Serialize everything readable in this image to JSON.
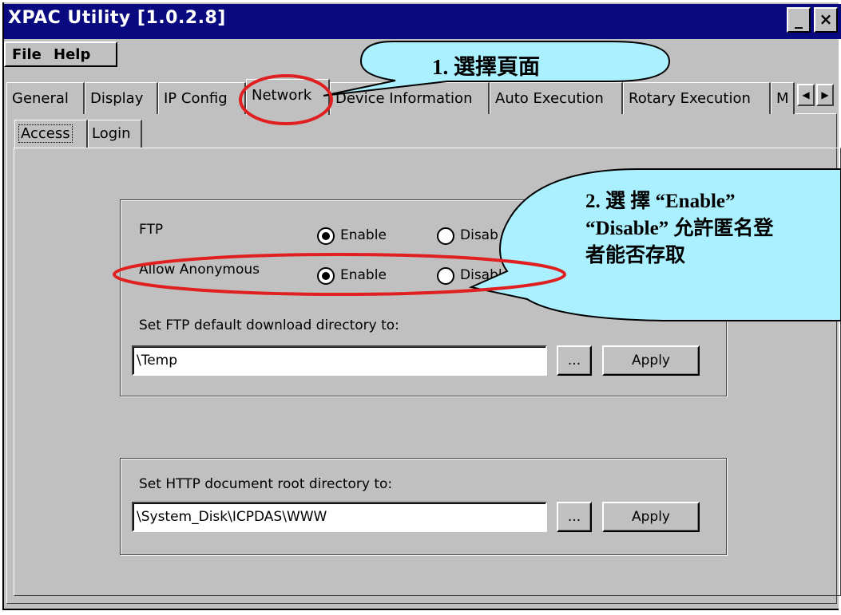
{
  "window": {
    "title": "XPAC Utility  [1.0.2.8]",
    "minimize_label": "_",
    "close_label": "×"
  },
  "menu": [
    "File",
    "Help"
  ],
  "tabs": [
    {
      "label": "General"
    },
    {
      "label": "Display"
    },
    {
      "label": "IP Config"
    },
    {
      "label": "Network",
      "active": true
    },
    {
      "label": "Device Information"
    },
    {
      "label": "Auto Execution"
    },
    {
      "label": "Rotary Execution"
    },
    {
      "label": "M"
    }
  ],
  "tab_scroll": {
    "left": "◀",
    "right": "▶"
  },
  "subtabs": [
    "Access",
    "Login"
  ],
  "ftp_group": {
    "ftp_label": "FTP",
    "enable_label": "Enable",
    "disable_label": "Disab",
    "ftp_value": "Enable",
    "anon_label": "Allow Anonymous",
    "anon_enable_label": "Enable",
    "anon_disable_label": "Disable",
    "anon_value": "Enable",
    "dir_label": "Set FTP default download directory to:",
    "dir_value": "\\Temp",
    "browse_label": "...",
    "apply_label": "Apply"
  },
  "http_group": {
    "dir_label": "Set HTTP document root directory to:",
    "dir_value": "\\System_Disk\\ICPDAS\\WWW",
    "browse_label": "...",
    "apply_label": "Apply"
  },
  "annotations": {
    "callout1": "1. 選擇頁面",
    "callout2_line1": "2.  選 擇 “Enable”",
    "callout2_line2": "“Disable” 允許匿名登",
    "callout2_line3": "者能否存取",
    "colors": {
      "callout_fill": "#aaf0ff",
      "highlight": "#e02020"
    }
  }
}
